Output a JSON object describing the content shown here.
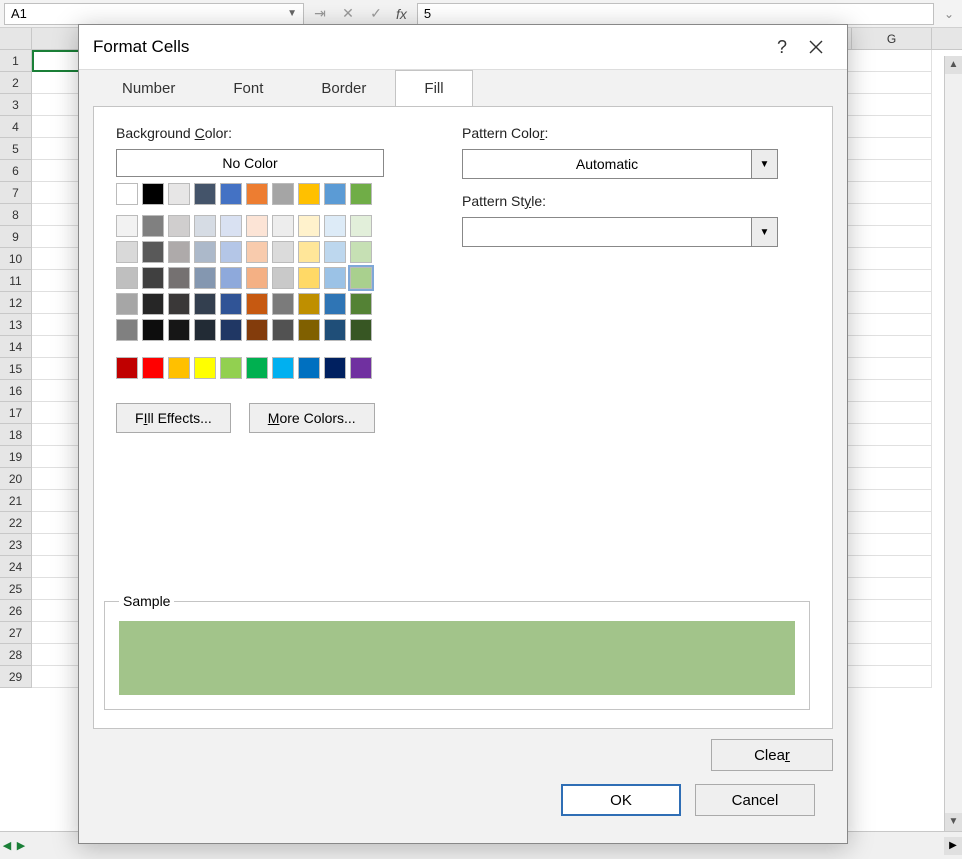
{
  "formula_bar": {
    "name_box": "A1",
    "fx_value": "5"
  },
  "grid": {
    "visible_column": "G",
    "row_count": 29
  },
  "dialog": {
    "title": "Format Cells",
    "help": "?",
    "tabs": [
      "Number",
      "Font",
      "Border",
      "Fill"
    ],
    "active_tab": "Fill",
    "background_label": "Background Color:",
    "background_accel": "C",
    "no_color": "No Color",
    "theme_row": [
      "#ffffff",
      "#000000",
      "#e7e6e6",
      "#44546a",
      "#4472c4",
      "#ed7d31",
      "#a5a5a5",
      "#ffc000",
      "#5b9bd5",
      "#70ad47"
    ],
    "theme_shades": [
      [
        "#f2f2f2",
        "#808080",
        "#d0cece",
        "#d6dce4",
        "#d9e1f2",
        "#fce4d6",
        "#ededed",
        "#fff2cc",
        "#ddebf7",
        "#e2efda"
      ],
      [
        "#d9d9d9",
        "#595959",
        "#aeaaaa",
        "#acb9ca",
        "#b4c6e7",
        "#f8cbad",
        "#dbdbdb",
        "#ffe699",
        "#bdd7ee",
        "#c6e0b4"
      ],
      [
        "#bfbfbf",
        "#404040",
        "#757171",
        "#8497b0",
        "#8ea9db",
        "#f4b084",
        "#c9c9c9",
        "#ffd966",
        "#9bc2e6",
        "#a9d08e"
      ],
      [
        "#a6a6a6",
        "#262626",
        "#3a3838",
        "#333f4f",
        "#305496",
        "#c65911",
        "#7b7b7b",
        "#bf8f00",
        "#2f75b5",
        "#548235"
      ],
      [
        "#808080",
        "#0d0d0d",
        "#161616",
        "#222b35",
        "#203764",
        "#833c0c",
        "#525252",
        "#806000",
        "#1f4e78",
        "#375623"
      ]
    ],
    "selected_theme": {
      "row": 2,
      "col": 9
    },
    "standard_colors": [
      "#c00000",
      "#ff0000",
      "#ffc000",
      "#ffff00",
      "#92d050",
      "#00b050",
      "#00b0f0",
      "#0070c0",
      "#002060",
      "#7030a0"
    ],
    "fill_effects": "Fill Effects...",
    "fill_effects_accel": "I",
    "more_colors": "More Colors...",
    "more_colors_accel": "M",
    "pattern_color_label": "Pattern Color:",
    "pattern_color_accel": "A",
    "pattern_color_value": "Automatic",
    "pattern_style_label": "Pattern Style:",
    "pattern_style_accel": "P",
    "pattern_style_value": "",
    "sample_label": "Sample",
    "sample_color": "#a2c48a",
    "clear": "Clear",
    "clear_accel": "r",
    "ok": "OK",
    "cancel": "Cancel"
  }
}
